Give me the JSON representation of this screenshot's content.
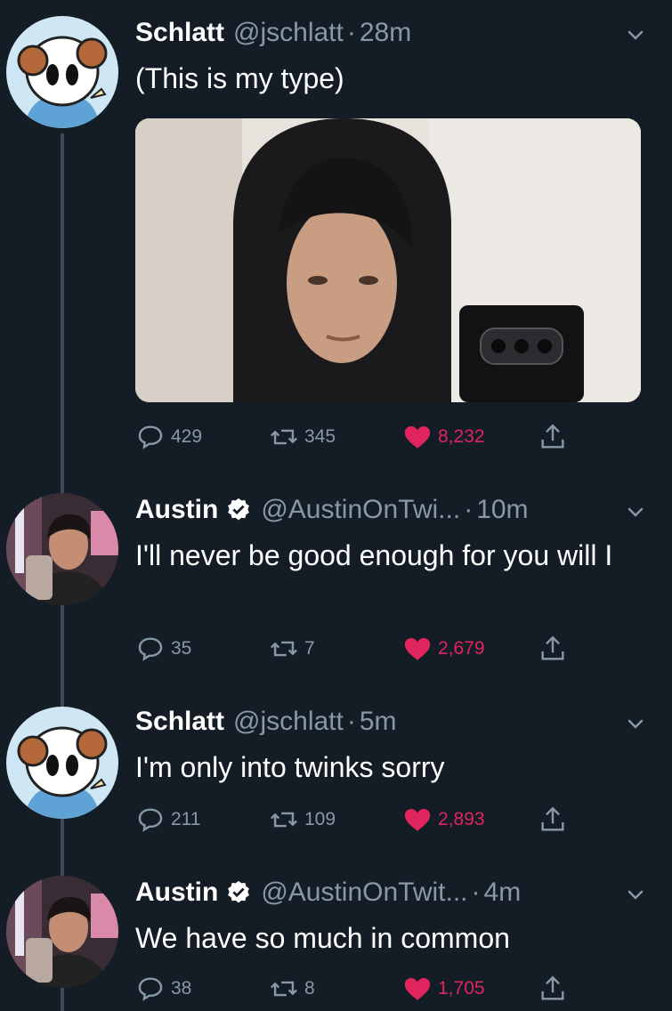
{
  "tweets": [
    {
      "name": "Schlatt",
      "handle": "@jschlatt",
      "time": "28m",
      "verified": false,
      "text": "(This is my type)",
      "replies": "429",
      "retweets": "345",
      "likes": "8,232"
    },
    {
      "name": "Austin",
      "handle": "@AustinOnTwi...",
      "time": "10m",
      "verified": true,
      "text": "I'll never be good enough for you will I",
      "replies": "35",
      "retweets": "7",
      "likes": "2,679"
    },
    {
      "name": "Schlatt",
      "handle": "@jschlatt",
      "time": "5m",
      "verified": false,
      "text": "I'm only into twinks sorry",
      "replies": "211",
      "retweets": "109",
      "likes": "2,893"
    },
    {
      "name": "Austin",
      "handle": "@AustinOnTwit...",
      "time": "4m",
      "verified": true,
      "text": "We have so much in common",
      "replies": "38",
      "retweets": "8",
      "likes": "1,705"
    }
  ],
  "separator": "·",
  "colors": {
    "background": "#141d26",
    "secondary_text": "#8899a6",
    "like": "#e0245e",
    "verified": "#ffffff"
  },
  "icons": [
    "reply-icon",
    "retweet-icon",
    "like-icon",
    "share-icon",
    "chevron-down-icon",
    "verified-icon"
  ]
}
